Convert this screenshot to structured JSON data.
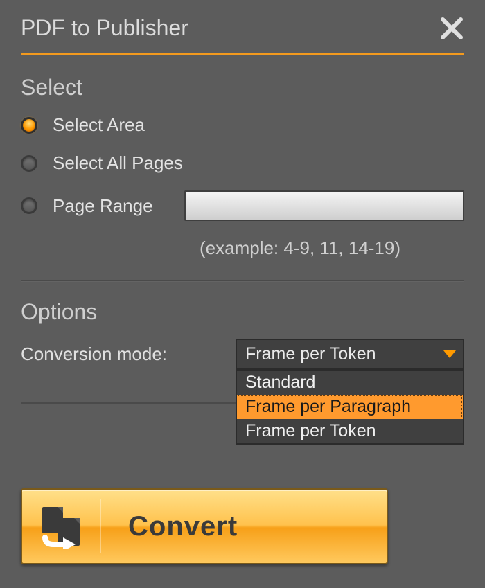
{
  "title": "PDF to Publisher",
  "select": {
    "heading": "Select",
    "options": [
      {
        "label": "Select Area",
        "selected": true
      },
      {
        "label": "Select All Pages",
        "selected": false
      },
      {
        "label": "Page Range",
        "selected": false
      }
    ],
    "page_range_value": "",
    "example": "(example: 4-9, 11, 14-19)"
  },
  "options": {
    "heading": "Options",
    "conversion_label": "Conversion mode:",
    "conversion_value": "Frame per Token",
    "dropdown_items": [
      "Standard",
      "Frame per Paragraph",
      "Frame per Token"
    ],
    "dropdown_highlight_index": 1
  },
  "convert_label": "Convert"
}
